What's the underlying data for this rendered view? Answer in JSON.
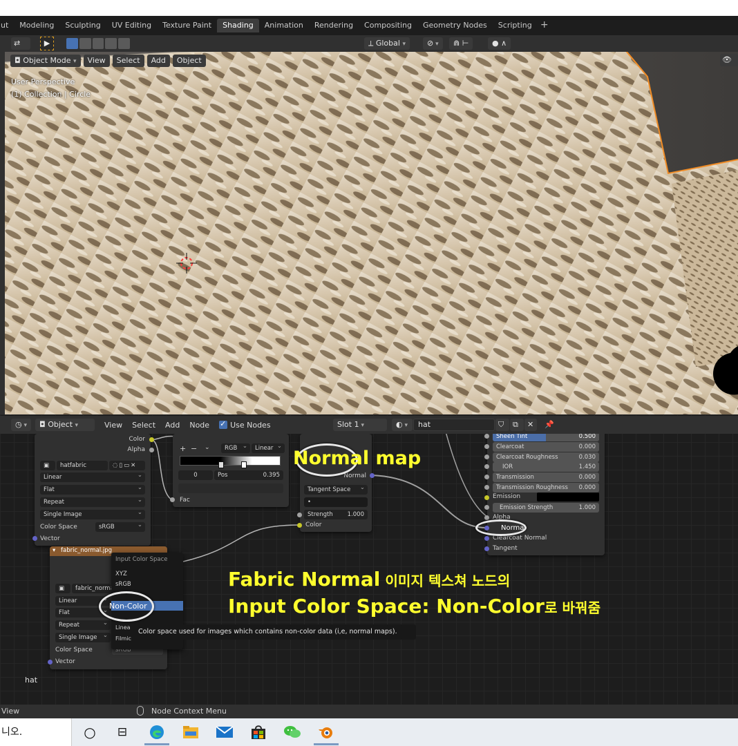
{
  "workspaces": {
    "tabs": [
      "ut",
      "Modeling",
      "Sculpting",
      "UV Editing",
      "Texture Paint",
      "Shading",
      "Animation",
      "Rendering",
      "Compositing",
      "Geometry Nodes",
      "Scripting"
    ],
    "active_index": 5,
    "add_label": "+"
  },
  "viewport": {
    "transform_orientation": "Global",
    "mode": "Object Mode",
    "menu": [
      "View",
      "Select",
      "Add",
      "Object"
    ],
    "info_line1": "User Perspective",
    "info_line2": "(1) Collection | Circle"
  },
  "node_editor": {
    "header": {
      "editor_mode": "Object",
      "menu": [
        "View",
        "Select",
        "Add",
        "Node"
      ],
      "use_nodes_label": "Use Nodes",
      "slot": "Slot 1",
      "material_name": "hat"
    },
    "image_node_top": {
      "out_color": "Color",
      "out_alpha": "Alpha",
      "image_name": "hatfabric",
      "interpolation": "Linear",
      "projection": "Flat",
      "extension": "Repeat",
      "source": "Single Image",
      "color_space_label": "Color Space",
      "color_space_value": "sRGB",
      "in_vector": "Vector"
    },
    "color_ramp": {
      "plus": "+",
      "minus": "−",
      "mode": "RGB",
      "interpolation": "Linear",
      "stop_index": "0",
      "pos_label": "Pos",
      "pos_value": "0.395",
      "in_fac": "Fac"
    },
    "normal_map_node": {
      "out_normal": "Normal",
      "space": "Tangent Space",
      "uv_placeholder": "•",
      "strength_label": "Strength",
      "strength_value": "1.000",
      "in_color": "Color"
    },
    "bsdf": {
      "rows": [
        {
          "label": "Sheen Tint",
          "value": "0.500",
          "highlight": true
        },
        {
          "label": "Clearcoat",
          "value": "0.000"
        },
        {
          "label": "Clearcoat Roughness",
          "value": "0.030"
        },
        {
          "label": "IOR",
          "value": "1.450"
        },
        {
          "label": "Transmission",
          "value": "0.000"
        },
        {
          "label": "Transmission Roughness",
          "value": "0.000"
        }
      ],
      "emission_label": "Emission",
      "emission_color": "#000000",
      "emission_strength_label": "Emission Strength",
      "emission_strength_value": "1.000",
      "alpha_label": "Alpha",
      "normal_label": "Normal",
      "clearcoat_normal_label": "Clearcoat Normal",
      "tangent_label": "Tangent"
    },
    "image_node_bottom": {
      "title": "fabric_normal.jpg",
      "image_name": "fabric_normal.j",
      "interpolation": "Linear",
      "projection": "Flat",
      "extension": "Repeat",
      "source": "Single Image",
      "color_space_label": "Color Space",
      "color_space_value": "sRGB",
      "in_vector": "Vector"
    },
    "color_space_menu": {
      "title": "Input Color Space",
      "items": [
        "XYZ",
        "sRGB",
        "Non-Color",
        "Linea",
        "Filmic"
      ],
      "selected": "Non-Color",
      "tooltip": "Color space used for images which contains non-color data (i,e, normal maps)."
    },
    "material_label": "hat"
  },
  "annotations": {
    "normal_map": "Normal map",
    "line1_bold": "Fabric Normal",
    "line1_korean": " 이미지 텍스쳐 노드의",
    "line2_bold": "Input Color Space: Non-Color",
    "line2_korean": "로 바꿔줌"
  },
  "status_bar": {
    "left_text": "View",
    "center_text": "Node Context Menu"
  },
  "taskbar": {
    "search_text": "니오."
  },
  "colors": {
    "accent_blue": "#4772b3",
    "annotation_yellow": "#ffff2e",
    "active_tab_bg": "#3d3d3d",
    "selection_outline": "#f08c26"
  }
}
